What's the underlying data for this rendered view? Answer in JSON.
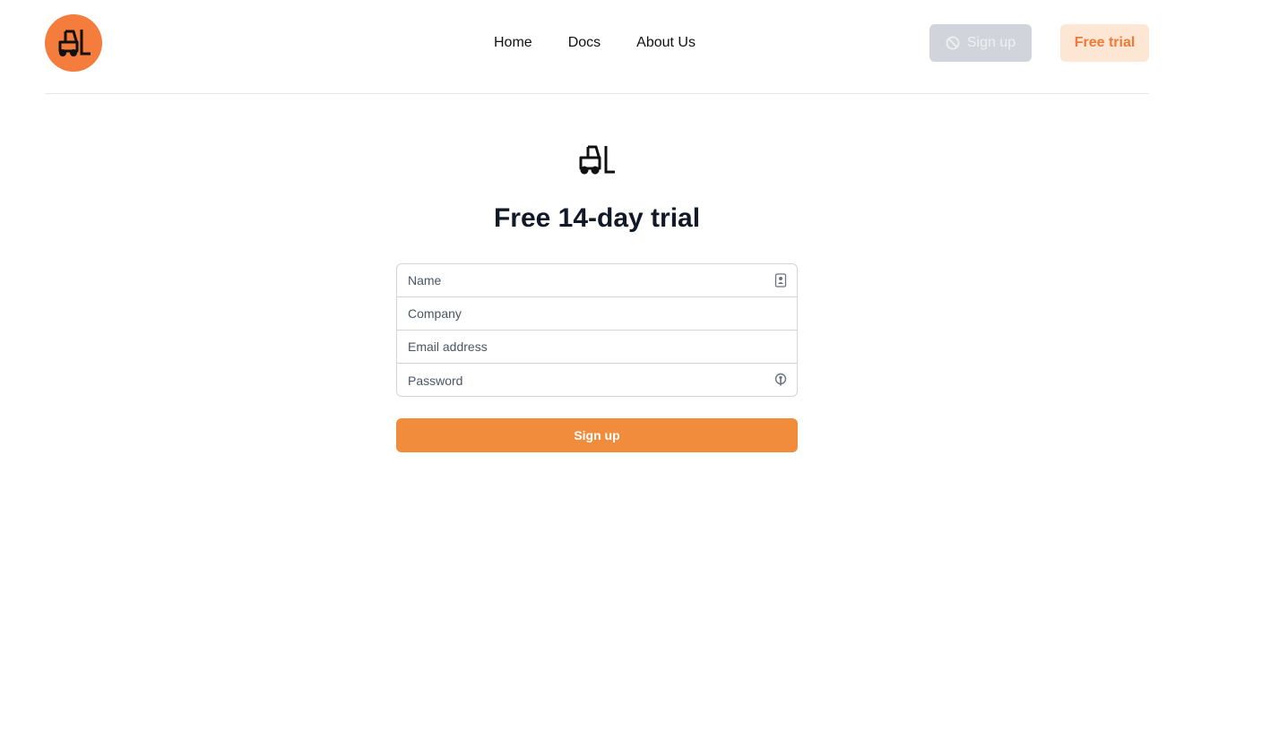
{
  "header": {
    "logo_icon": "forklift-icon",
    "nav": [
      {
        "label": "Home"
      },
      {
        "label": "Docs"
      },
      {
        "label": "About Us"
      }
    ],
    "signup_button": {
      "label": "Sign up",
      "icon": "ban-icon",
      "state": "disabled"
    },
    "free_trial_button": {
      "label": "Free trial"
    }
  },
  "main": {
    "icon": "forklift-icon",
    "title": "Free 14-day trial",
    "form": {
      "fields": [
        {
          "placeholder": "Name",
          "value": "",
          "icon": "contact-card-icon"
        },
        {
          "placeholder": "Company",
          "value": ""
        },
        {
          "placeholder": "Email address",
          "value": ""
        },
        {
          "placeholder": "Password",
          "value": "",
          "icon": "key-icon"
        }
      ],
      "submit_label": "Sign up"
    }
  },
  "colors": {
    "brand_orange": "#f47c3c",
    "button_orange": "#f08c3c",
    "free_trial_bg": "#fde6d4",
    "free_trial_text": "#f07a36",
    "disabled_bg": "#d1d5db"
  }
}
